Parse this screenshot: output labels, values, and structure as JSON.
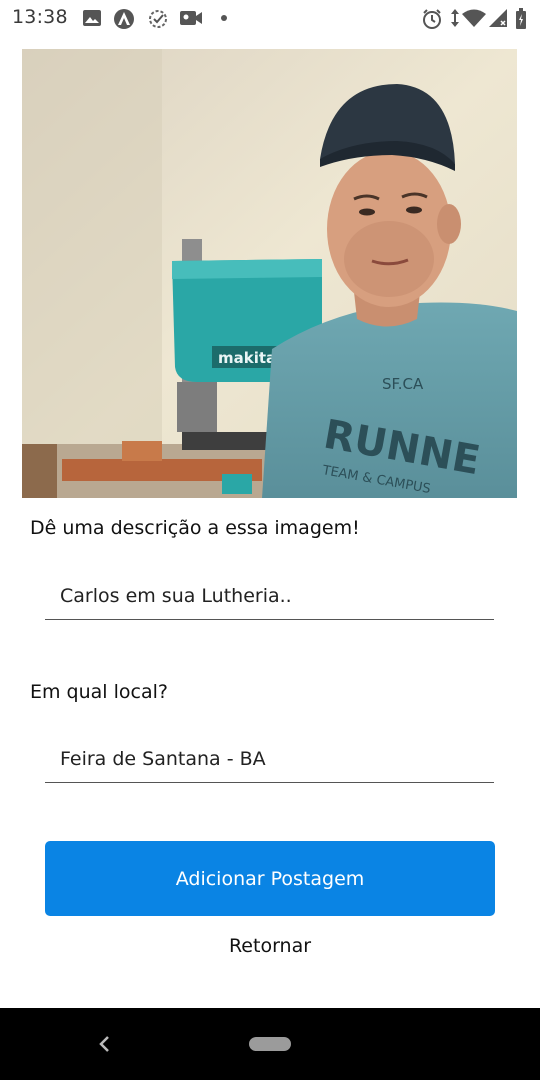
{
  "status_bar": {
    "time": "13:38",
    "left_icons": [
      "image-icon",
      "app-notification-icon",
      "sync-icon",
      "video-icon",
      "dot-icon"
    ],
    "right_icons": [
      "alarm-icon",
      "data-arrows-icon",
      "wifi-icon",
      "signal-icon",
      "battery-icon"
    ]
  },
  "photo": {
    "icon": "photo-preview",
    "shirt_text_1": "SF.CA",
    "shirt_text_2": "RUNNE",
    "shirt_text_3": "TEAM & CAMPUS",
    "machine_brand": "makita"
  },
  "form": {
    "description_label": "Dê uma descrição a essa imagem!",
    "description_value": "Carlos em sua Lutheria..",
    "location_label": "Em qual local?",
    "location_value": "Feira de Santana - BA",
    "submit_label": "Adicionar Postagem",
    "back_label": "Retornar"
  },
  "nav_bar": {
    "back_icon": "back-chevron-icon",
    "home_icon": "home-pill-icon"
  },
  "colors": {
    "accent": "#0a84e4",
    "nav_bg": "#000000",
    "text": "#111111"
  }
}
